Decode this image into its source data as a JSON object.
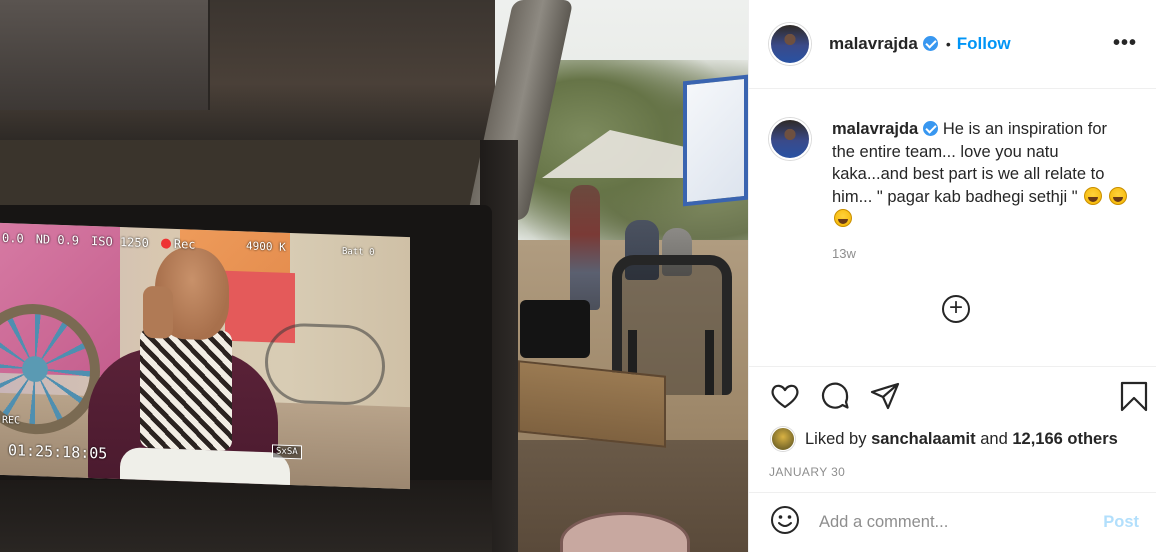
{
  "photo": {
    "monitor_hud": {
      "top_left": "0.0",
      "nd": "ND 0.9",
      "iso": "ISO 1250",
      "rec": "Rec",
      "color_temp": "4900 K",
      "batt": "Batt 0",
      "timecode": "01:25:18:05",
      "rec_label": "REC",
      "lens": "SxSA"
    }
  },
  "post": {
    "author": {
      "username": "malavrajda",
      "verified": true,
      "follow_label": "Follow",
      "separator": "•"
    },
    "more_label": "•••",
    "caption": {
      "username": "malavrajda",
      "text": "He is an inspiration for the entire team... love you natu kaka...and best part is we all relate to him... \" pagar kab badhegi sethji \"",
      "time": "13w"
    },
    "load_more_label": "+",
    "actions": [
      "like-icon",
      "comment-icon",
      "share-icon",
      "save-icon"
    ],
    "likes": {
      "prefix": "Liked by",
      "user": "sanchalaamit",
      "connector": "and",
      "others": "12,166 others"
    },
    "date": "JANUARY 30",
    "comment": {
      "placeholder": "Add a comment...",
      "post_label": "Post"
    },
    "colors": {
      "link_blue": "#0095f6",
      "post_disabled": "#b2dffc",
      "muted": "#8e8e8e",
      "verified": "#3897f0"
    }
  }
}
